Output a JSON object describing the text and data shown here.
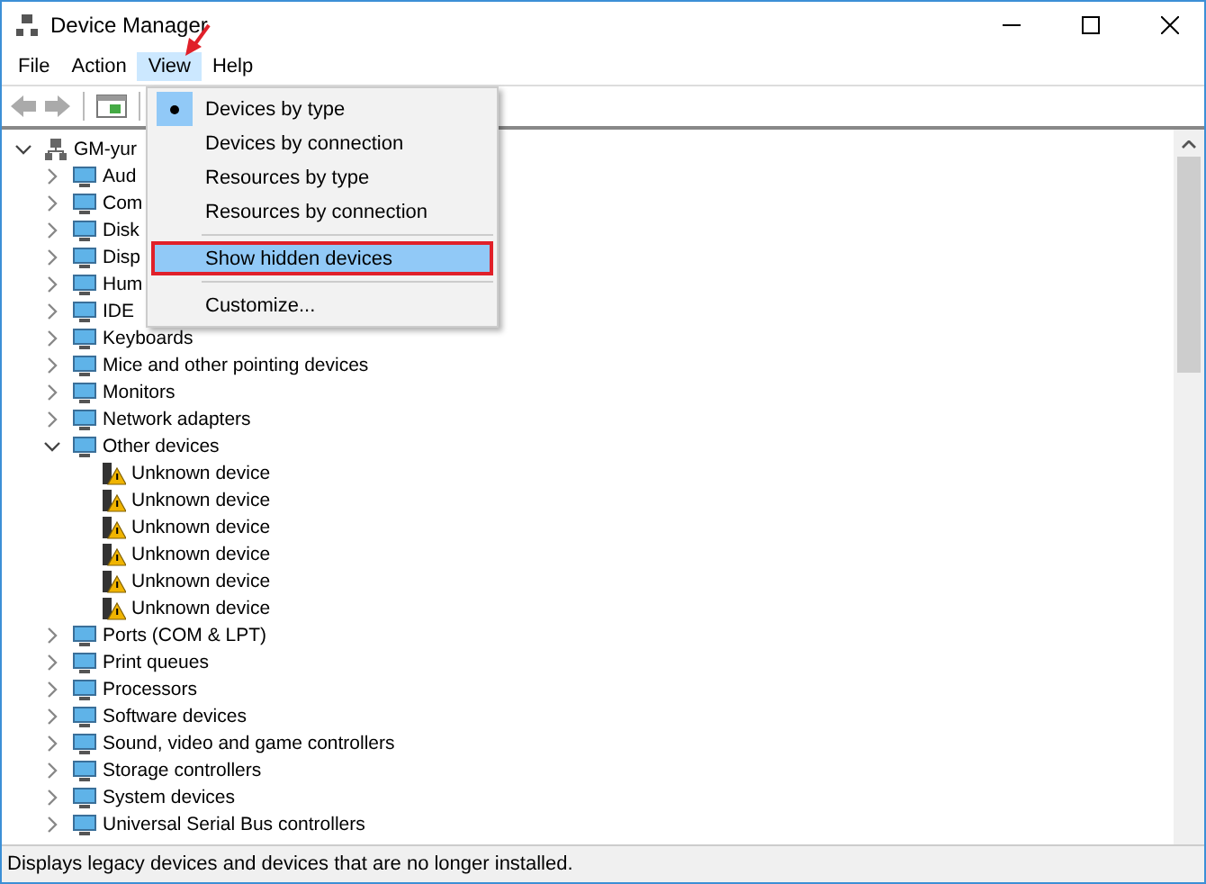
{
  "window": {
    "title": "Device Manager"
  },
  "menu_bar": [
    {
      "label": "File",
      "selected": false
    },
    {
      "label": "Action",
      "selected": false
    },
    {
      "label": "View",
      "selected": true
    },
    {
      "label": "Help",
      "selected": false
    }
  ],
  "view_menu": {
    "groups": [
      [
        {
          "label": "Devices by type",
          "selected": true,
          "highlighted": false
        },
        {
          "label": "Devices by connection",
          "selected": false,
          "highlighted": false
        },
        {
          "label": "Resources by type",
          "selected": false,
          "highlighted": false
        },
        {
          "label": "Resources by connection",
          "selected": false,
          "highlighted": false
        }
      ],
      [
        {
          "label": "Show hidden devices",
          "selected": false,
          "highlighted": true
        }
      ],
      [
        {
          "label": "Customize...",
          "selected": false,
          "highlighted": false
        }
      ]
    ]
  },
  "tree": {
    "label": "GM-yur",
    "expanded": true,
    "children": [
      {
        "label": "Aud",
        "kind": "category",
        "expanded": false
      },
      {
        "label": "Com",
        "kind": "category",
        "expanded": false
      },
      {
        "label": "Disk",
        "kind": "category",
        "expanded": false
      },
      {
        "label": "Disp",
        "kind": "category",
        "expanded": false
      },
      {
        "label": "Hum",
        "kind": "category",
        "expanded": false
      },
      {
        "label": "IDE",
        "kind": "category",
        "expanded": false
      },
      {
        "label": "Keyboards",
        "kind": "category",
        "expanded": false
      },
      {
        "label": "Mice and other pointing devices",
        "kind": "category",
        "expanded": false
      },
      {
        "label": "Monitors",
        "kind": "category",
        "expanded": false
      },
      {
        "label": "Network adapters",
        "kind": "category",
        "expanded": false
      },
      {
        "label": "Other devices",
        "kind": "category",
        "expanded": true,
        "children": [
          {
            "label": "Unknown device",
            "kind": "warning"
          },
          {
            "label": "Unknown device",
            "kind": "warning"
          },
          {
            "label": "Unknown device",
            "kind": "warning"
          },
          {
            "label": "Unknown device",
            "kind": "warning"
          },
          {
            "label": "Unknown device",
            "kind": "warning"
          },
          {
            "label": "Unknown device",
            "kind": "warning"
          }
        ]
      },
      {
        "label": "Ports (COM & LPT)",
        "kind": "category",
        "expanded": false
      },
      {
        "label": "Print queues",
        "kind": "category",
        "expanded": false
      },
      {
        "label": "Processors",
        "kind": "category",
        "expanded": false
      },
      {
        "label": "Software devices",
        "kind": "category",
        "expanded": false
      },
      {
        "label": "Sound, video and game controllers",
        "kind": "category",
        "expanded": false
      },
      {
        "label": "Storage controllers",
        "kind": "category",
        "expanded": false
      },
      {
        "label": "System devices",
        "kind": "category",
        "expanded": false
      },
      {
        "label": "Universal Serial Bus controllers",
        "kind": "category",
        "expanded": false
      }
    ]
  },
  "status_bar": "Displays legacy devices and devices that are no longer installed."
}
